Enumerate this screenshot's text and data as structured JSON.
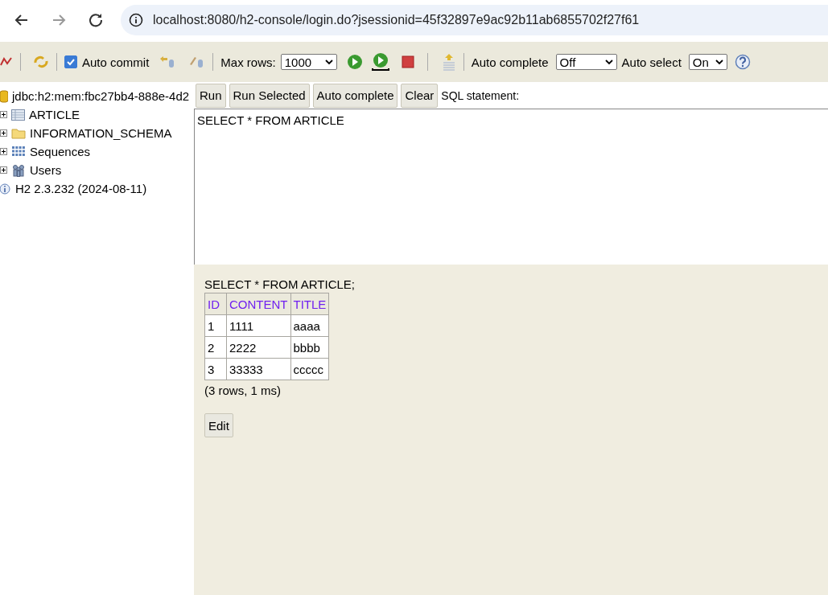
{
  "browser": {
    "url": "localhost:8080/h2-console/login.do?jsessionid=45f32897e9ac92b11ab6855702f27f61"
  },
  "toolbar": {
    "auto_commit": {
      "label": "Auto commit",
      "checked": true
    },
    "max_rows": {
      "label": "Max rows:",
      "value": "1000"
    },
    "auto_complete": {
      "label": "Auto complete",
      "value": "Off"
    },
    "auto_select": {
      "label": "Auto select",
      "value": "On"
    }
  },
  "tree": {
    "connection": "jdbc:h2:mem:fbc27bb4-888e-4d2",
    "items": [
      {
        "kind": "table",
        "label": "ARTICLE"
      },
      {
        "kind": "folder",
        "label": "INFORMATION_SCHEMA"
      },
      {
        "kind": "sequences",
        "label": "Sequences"
      },
      {
        "kind": "users",
        "label": "Users"
      }
    ],
    "version": "H2 2.3.232 (2024-08-11)"
  },
  "query_buttons": [
    "Run",
    "Run Selected",
    "Auto complete",
    "Clear"
  ],
  "sql_label": "SQL statement:",
  "sql": "SELECT * FROM ARTICLE",
  "result": {
    "statement": "SELECT * FROM ARTICLE;",
    "columns": [
      "ID",
      "CONTENT",
      "TITLE"
    ],
    "rows": [
      [
        "1",
        "1111",
        "aaaa"
      ],
      [
        "2",
        "2222",
        "bbbb"
      ],
      [
        "3",
        "33333",
        "ccccc"
      ]
    ],
    "summary": "(3 rows, 1 ms)",
    "edit_button": "Edit"
  }
}
